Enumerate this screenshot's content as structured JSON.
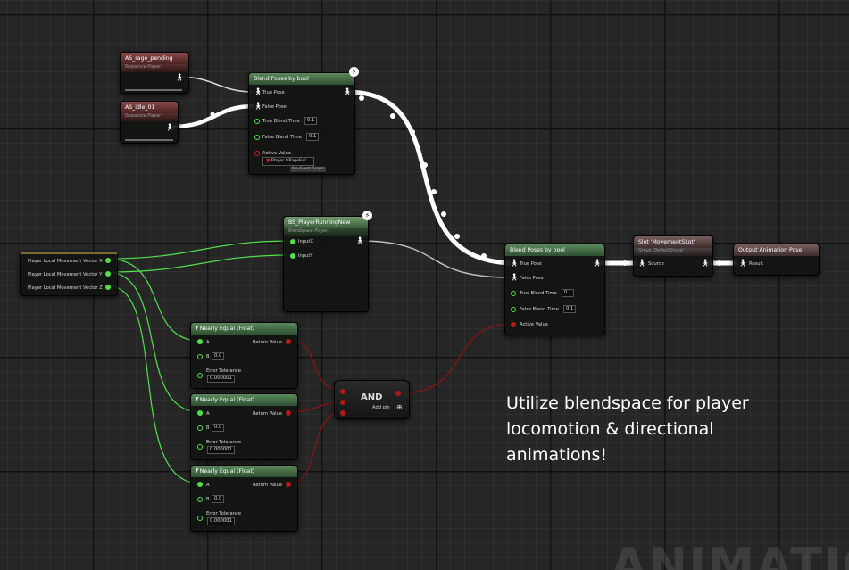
{
  "graph": {
    "seq_pending": {
      "title": "AS_rage_pending",
      "subtitle": "Sequence Player"
    },
    "seq_idle": {
      "title": "AS_idle_01",
      "subtitle": "Sequence Player"
    },
    "blend_top": {
      "title": "Blend Poses by bool",
      "true_pose": "True Pose",
      "false_pose": "False Pose",
      "true_blend": "True Blend Time",
      "true_blend_value": "0.1",
      "false_blend": "False Blend Time",
      "false_blend_value": "0.1",
      "active_value": "Active Value",
      "active_dropdown": "Player IsRageFull",
      "active_tag": "Pre-Event Graph"
    },
    "blendspace": {
      "title": "BS_PlayerRunningNew",
      "subtitle": "Blendspace Player",
      "input_x": "InputX",
      "input_y": "InputY"
    },
    "vector": {
      "x": "Player Local Movement Vector X",
      "y": "Player Local Movement Vector Y",
      "z": "Player Local Movement Vector Z"
    },
    "blend_bottom": {
      "title": "Blend Poses by bool",
      "true_pose": "True Pose",
      "false_pose": "False Pose",
      "true_blend": "True Blend Time",
      "true_blend_value": "0.1",
      "false_blend": "False Blend Time",
      "false_blend_value": "0.1",
      "active_value": "Active Value"
    },
    "slot": {
      "title": "Slot 'MovementSLot'",
      "subtitle": "Group 'DefaultGroup'",
      "source": "Source"
    },
    "output": {
      "title": "Output Animation Pose",
      "result": "Result"
    },
    "nearly_equal": [
      {
        "title": "Nearly Equal (Float)",
        "a": "A",
        "b": "B",
        "b_value": "0.0",
        "tol": "Error Tolerance",
        "tol_value": "0.000001",
        "ret": "Return Value"
      },
      {
        "title": "Nearly Equal (Float)",
        "a": "A",
        "b": "B",
        "b_value": "0.0",
        "tol": "Error Tolerance",
        "tol_value": "0.000001",
        "ret": "Return Value"
      },
      {
        "title": "Nearly Equal (Float)",
        "a": "A",
        "b": "B",
        "b_value": "0.0",
        "tol": "Error Tolerance",
        "tol_value": "0.000001",
        "ret": "Return Value"
      }
    ],
    "and_node": {
      "title": "AND",
      "add_pin": "Add pin"
    }
  },
  "annotation": {
    "text": "Utilize blendspace for player locomotion & directional animations!"
  },
  "watermark": {
    "text": "ANIMATION"
  },
  "colors": {
    "exec_white": "#ffffff",
    "float_green": "#4fe04b",
    "bool_red": "#b01a1a",
    "header_green": "#4a7a4a",
    "header_red": "#7a3a3a"
  },
  "icons": [
    "pose-icon",
    "lightning-icon",
    "function-icon",
    "add-pin-icon",
    "dropdown-chevron-icon"
  ]
}
